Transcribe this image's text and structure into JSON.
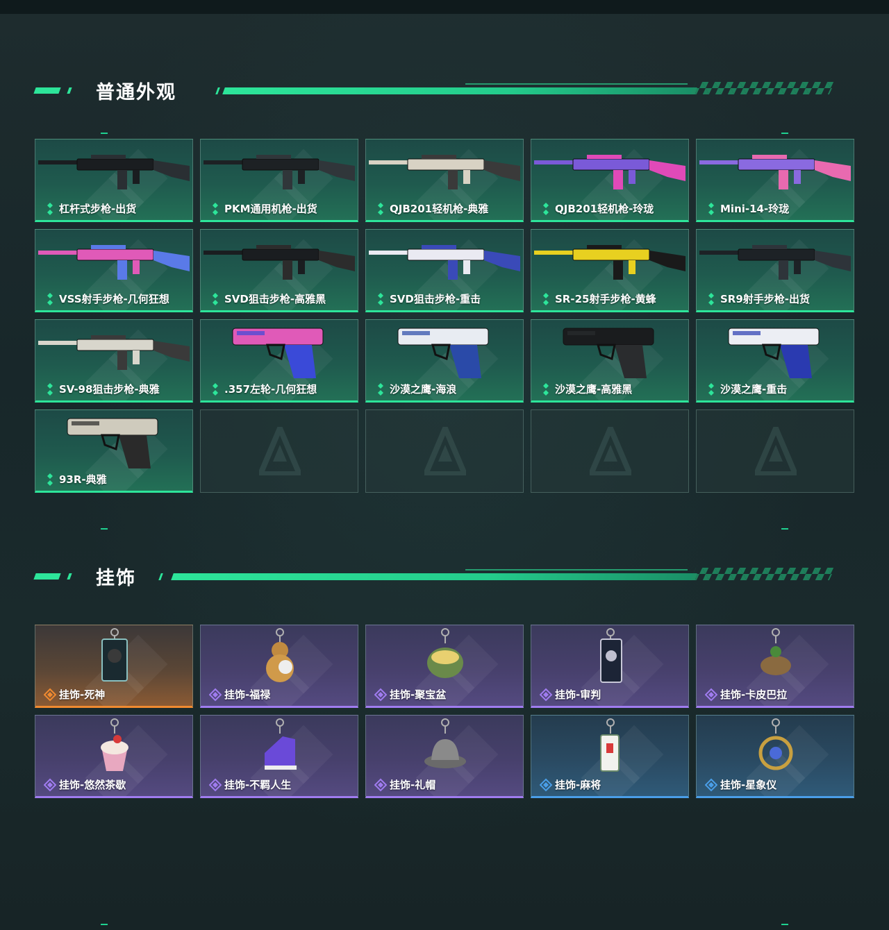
{
  "sections": {
    "skins": {
      "title": "普通外观",
      "items": [
        {
          "label": "杠杆式步枪-出货",
          "rarity": "green",
          "icon": "lever-rifle-icon"
        },
        {
          "label": "PKM通用机枪-出货",
          "rarity": "green",
          "icon": "machine-gun-icon"
        },
        {
          "label": "QJB201轻机枪-典雅",
          "rarity": "green",
          "icon": "light-machine-gun-icon"
        },
        {
          "label": "QJB201轻机枪-玲珑",
          "rarity": "green",
          "icon": "light-machine-gun-icon"
        },
        {
          "label": "Mini-14-玲珑",
          "rarity": "green",
          "icon": "rifle-icon"
        },
        {
          "label": "VSS射手步枪-几何狂想",
          "rarity": "green",
          "icon": "marksman-rifle-icon"
        },
        {
          "label": "SVD狙击步枪-高雅黑",
          "rarity": "green",
          "icon": "sniper-rifle-icon"
        },
        {
          "label": "SVD狙击步枪-重击",
          "rarity": "green",
          "icon": "sniper-rifle-icon"
        },
        {
          "label": "SR-25射手步枪-黄蜂",
          "rarity": "green",
          "icon": "marksman-rifle-icon"
        },
        {
          "label": "SR9射手步枪-出货",
          "rarity": "green",
          "icon": "marksman-rifle-icon"
        },
        {
          "label": "SV-98狙击步枪-典雅",
          "rarity": "green",
          "icon": "sniper-rifle-icon"
        },
        {
          "label": ".357左轮-几何狂想",
          "rarity": "green",
          "icon": "revolver-icon"
        },
        {
          "label": "沙漠之鹰-海浪",
          "rarity": "green",
          "icon": "pistol-icon"
        },
        {
          "label": "沙漠之鹰-高雅黑",
          "rarity": "green",
          "icon": "pistol-icon"
        },
        {
          "label": "沙漠之鹰-重击",
          "rarity": "green",
          "icon": "pistol-icon"
        },
        {
          "label": "93R-典雅",
          "rarity": "green",
          "icon": "pistol-icon"
        }
      ]
    },
    "charms": {
      "title": "挂饰",
      "items": [
        {
          "label": "挂饰-死神",
          "rarity": "orange",
          "icon": "reaper-card-charm-icon"
        },
        {
          "label": "挂饰-福禄",
          "rarity": "purple",
          "icon": "gourd-charm-icon"
        },
        {
          "label": "挂饰-聚宝盆",
          "rarity": "purple",
          "icon": "treasure-bowl-charm-icon"
        },
        {
          "label": "挂饰-审判",
          "rarity": "purple",
          "icon": "judgment-card-charm-icon"
        },
        {
          "label": "挂饰-卡皮巴拉",
          "rarity": "purple",
          "icon": "capybara-charm-icon"
        },
        {
          "label": "挂饰-悠然茶歇",
          "rarity": "purple",
          "icon": "cupcake-charm-icon"
        },
        {
          "label": "挂饰-不羁人生",
          "rarity": "purple",
          "icon": "sneaker-charm-icon"
        },
        {
          "label": "挂饰-礼帽",
          "rarity": "purple",
          "icon": "hat-charm-icon"
        },
        {
          "label": "挂饰-麻将",
          "rarity": "blue",
          "icon": "mahjong-tile-charm-icon"
        },
        {
          "label": "挂饰-星象仪",
          "rarity": "blue",
          "icon": "astrolabe-charm-icon"
        }
      ]
    }
  },
  "colors": {
    "accent": "#2de59a",
    "green_rarity": "#2de59a",
    "orange_rarity": "#f08a30",
    "purple_rarity": "#a07cf0",
    "blue_rarity": "#4a9ee8"
  }
}
